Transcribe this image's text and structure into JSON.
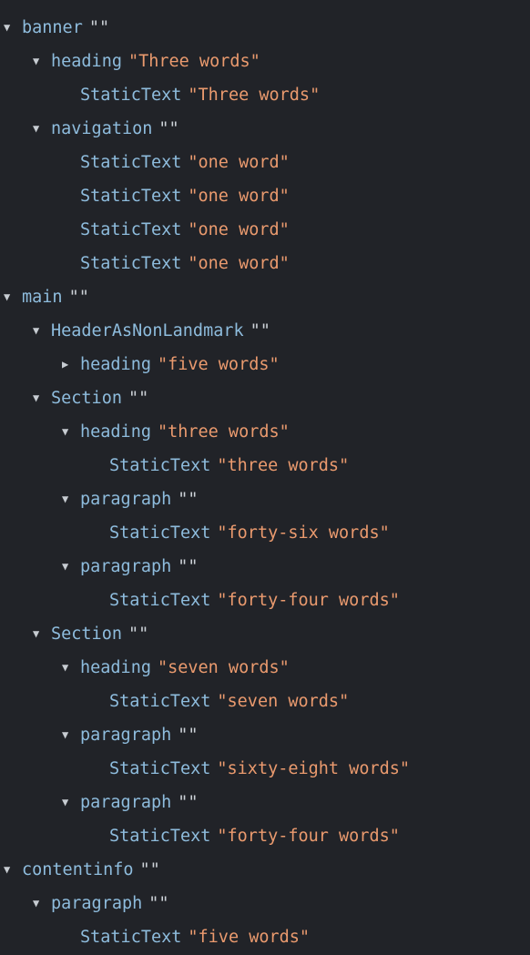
{
  "viewer": {
    "name": "accessibility-tree",
    "background_color": "#212328",
    "role_color": "#8ebcdd",
    "value_color": "#ea9a6e",
    "empty_value_color": "#cdd2d8",
    "twisty_color": "#c7ccd2",
    "expanded_glyph": "▼",
    "collapsed_glyph": "▶",
    "empty_value": "\"\"",
    "quote": "\""
  },
  "nodes": [
    {
      "depth": 2,
      "twisty": "none",
      "role": "",
      "value": "",
      "clipped": true
    },
    {
      "depth": 1,
      "twisty": "expanded",
      "role": "banner",
      "value": ""
    },
    {
      "depth": 2,
      "twisty": "expanded",
      "role": "heading",
      "value": "Three words"
    },
    {
      "depth": 3,
      "twisty": "none",
      "role": "StaticText",
      "value": "Three words"
    },
    {
      "depth": 2,
      "twisty": "expanded",
      "role": "navigation",
      "value": ""
    },
    {
      "depth": 3,
      "twisty": "none",
      "role": "StaticText",
      "value": "one word"
    },
    {
      "depth": 3,
      "twisty": "none",
      "role": "StaticText",
      "value": "one word"
    },
    {
      "depth": 3,
      "twisty": "none",
      "role": "StaticText",
      "value": "one word"
    },
    {
      "depth": 3,
      "twisty": "none",
      "role": "StaticText",
      "value": "one word"
    },
    {
      "depth": 1,
      "twisty": "expanded",
      "role": "main",
      "value": ""
    },
    {
      "depth": 2,
      "twisty": "expanded",
      "role": "HeaderAsNonLandmark",
      "value": ""
    },
    {
      "depth": 3,
      "twisty": "collapsed",
      "role": "heading",
      "value": "five words"
    },
    {
      "depth": 2,
      "twisty": "expanded",
      "role": "Section",
      "value": ""
    },
    {
      "depth": 3,
      "twisty": "expanded",
      "role": "heading",
      "value": "three words"
    },
    {
      "depth": 4,
      "twisty": "none",
      "role": "StaticText",
      "value": "three words"
    },
    {
      "depth": 3,
      "twisty": "expanded",
      "role": "paragraph",
      "value": ""
    },
    {
      "depth": 4,
      "twisty": "none",
      "role": "StaticText",
      "value": "forty-six words"
    },
    {
      "depth": 3,
      "twisty": "expanded",
      "role": "paragraph",
      "value": ""
    },
    {
      "depth": 4,
      "twisty": "none",
      "role": "StaticText",
      "value": "forty-four words"
    },
    {
      "depth": 2,
      "twisty": "expanded",
      "role": "Section",
      "value": ""
    },
    {
      "depth": 3,
      "twisty": "expanded",
      "role": "heading",
      "value": "seven words"
    },
    {
      "depth": 4,
      "twisty": "none",
      "role": "StaticText",
      "value": "seven words"
    },
    {
      "depth": 3,
      "twisty": "expanded",
      "role": "paragraph",
      "value": ""
    },
    {
      "depth": 4,
      "twisty": "none",
      "role": "StaticText",
      "value": "sixty-eight words"
    },
    {
      "depth": 3,
      "twisty": "expanded",
      "role": "paragraph",
      "value": ""
    },
    {
      "depth": 4,
      "twisty": "none",
      "role": "StaticText",
      "value": "forty-four words"
    },
    {
      "depth": 1,
      "twisty": "expanded",
      "role": "contentinfo",
      "value": ""
    },
    {
      "depth": 2,
      "twisty": "expanded",
      "role": "paragraph",
      "value": ""
    },
    {
      "depth": 3,
      "twisty": "none",
      "role": "StaticText",
      "value": "five words"
    }
  ]
}
